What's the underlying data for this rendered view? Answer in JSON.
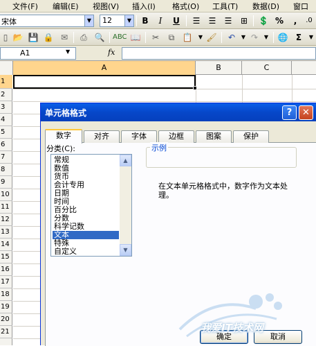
{
  "menubar": {
    "items": [
      "文件(F)",
      "编辑(E)",
      "视图(V)",
      "插入(I)",
      "格式(O)",
      "工具(T)",
      "数据(D)",
      "窗口"
    ]
  },
  "format_toolbar": {
    "font_name": "宋体",
    "font_size": "12",
    "bold": "B",
    "italic": "I",
    "underline": "U",
    "percent": "%",
    "comma": ","
  },
  "standard_toolbar": {
    "sum": "Σ"
  },
  "formula_bar": {
    "name_box": "A1",
    "fx": "fx",
    "formula": ""
  },
  "sheet": {
    "columns": [
      "A",
      "B",
      "C"
    ],
    "rows": [
      "1",
      "2",
      "3",
      "4",
      "5",
      "6",
      "7",
      "8",
      "9",
      "10",
      "11",
      "12",
      "13",
      "14",
      "15",
      "16",
      "17",
      "18",
      "19",
      "20",
      "21"
    ]
  },
  "dialog": {
    "title": "单元格格式",
    "help": "?",
    "close": "✕",
    "tabs": [
      "数字",
      "对齐",
      "字体",
      "边框",
      "图案",
      "保护"
    ],
    "active_tab": "数字",
    "category_label": "分类(C):",
    "categories": [
      "常规",
      "数值",
      "货币",
      "会计专用",
      "日期",
      "时间",
      "百分比",
      "分数",
      "科学记数",
      "文本",
      "特殊",
      "自定义"
    ],
    "selected_category": "文本",
    "sample_label": "示例",
    "description": "在文本单元格格式中，数字作为文本处理。",
    "ok": "确定",
    "cancel": "取消"
  },
  "watermark": {
    "text": "我爱IT技术网"
  },
  "colors": {
    "title_bar": "#0a5ee8",
    "selected_item": "#316ac5",
    "active_tab_accent": "#ffc83c",
    "toolbar_bg": "#ece9d8"
  }
}
